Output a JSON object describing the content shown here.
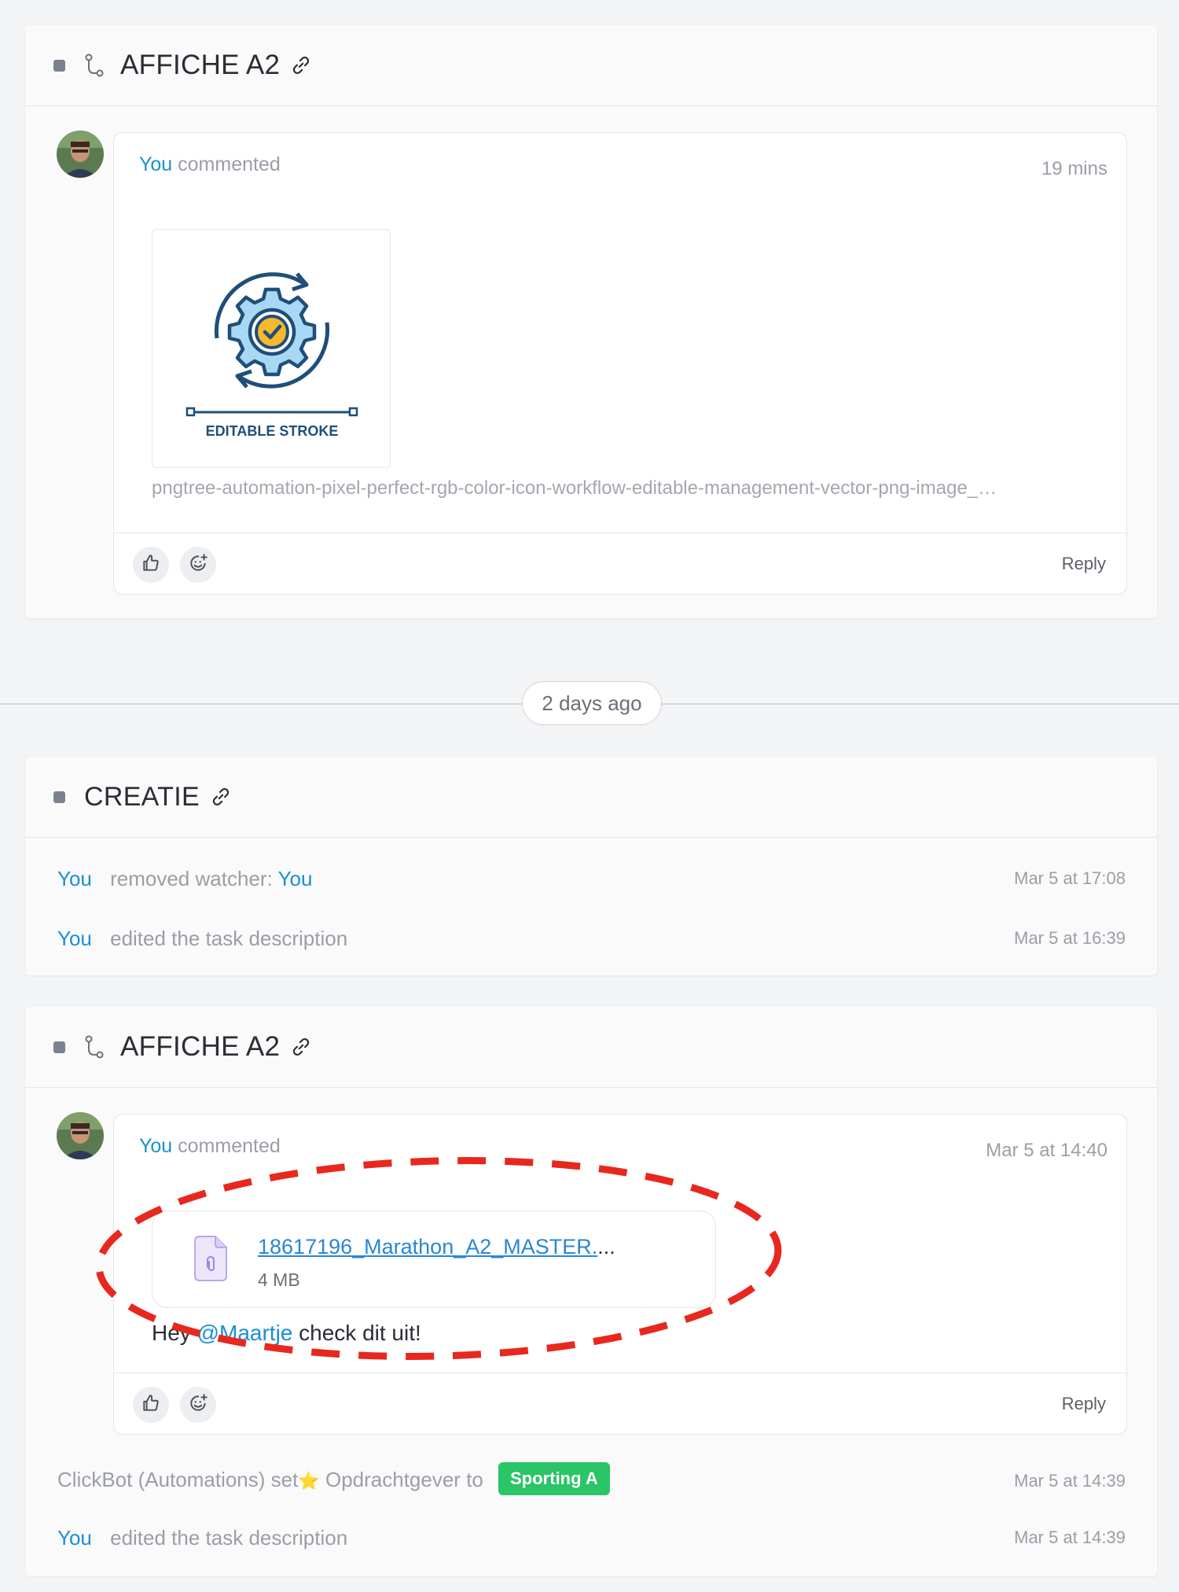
{
  "section1": {
    "title": "AFFICHE A2",
    "comment": {
      "author": "You",
      "action": "commented",
      "time": "19 mins",
      "thumbnail_text": "EDITABLE STROKE",
      "filename": "pngtree-automation-pixel-perfect-rgb-color-icon-workflow-editable-management-vector-png-image_…",
      "reply_label": "Reply"
    }
  },
  "divider": {
    "label": "2 days ago"
  },
  "section2": {
    "title": "CREATIE",
    "activities": [
      {
        "actor": "You",
        "text": "removed watcher:",
        "target": "You",
        "time": "Mar 5 at 17:08"
      },
      {
        "actor": "You",
        "text": "edited the task description",
        "time": "Mar 5 at 16:39"
      }
    ]
  },
  "section3": {
    "title": "AFFICHE A2",
    "comment": {
      "author": "You",
      "action": "commented",
      "time": "Mar 5 at 14:40",
      "file_name": "18617196_Marathon_A2_MASTER.",
      "file_name_ellipsis": "...",
      "file_size": "4 MB",
      "message_prefix": "Hey",
      "mention": "@Maartje",
      "message_suffix": "check dit uit!",
      "reply_label": "Reply"
    },
    "automation": {
      "actor": "ClickBot (Automations)",
      "text_set": "set",
      "star": "⭐",
      "field": "Opdrachtgever",
      "text_to": "to",
      "value": "Sporting A",
      "value_color": "#2bc466",
      "time": "Mar 5 at 14:39"
    },
    "activity": {
      "actor": "You",
      "text": "edited the task description",
      "time": "Mar 5 at 14:39"
    }
  },
  "colors": {
    "accent": "#1a8fd4",
    "annotation": "#e8281e"
  }
}
